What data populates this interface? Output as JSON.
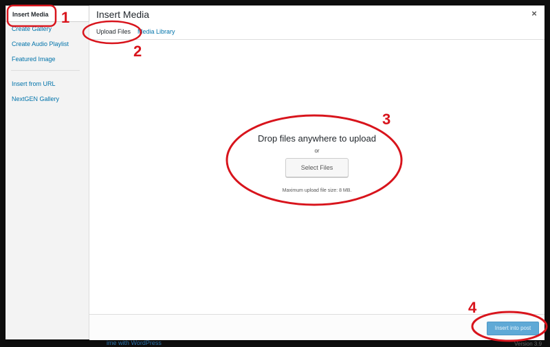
{
  "backdrop": {
    "footer_text": "ime with WordPress",
    "version": "Version 3.9"
  },
  "menu": {
    "items": [
      {
        "label": "Insert Media",
        "active": true
      },
      {
        "label": "Create Gallery"
      },
      {
        "label": "Create Audio Playlist"
      },
      {
        "label": "Featured Image"
      },
      {
        "label": "Insert from URL"
      },
      {
        "label": "NextGEN Gallery"
      }
    ]
  },
  "frame": {
    "title": "Insert Media",
    "close_glyph": "×",
    "tabs": [
      {
        "label": "Upload Files",
        "active": true
      },
      {
        "label": "Media Library"
      }
    ]
  },
  "uploader": {
    "drop_title": "Drop files anywhere to upload",
    "or_text": "or",
    "select_button": "Select Files",
    "max_size": "Maximum upload file size: 8 MB."
  },
  "toolbar": {
    "insert_button": "Insert into post"
  },
  "annotations": {
    "color": "#d8141c",
    "labels": [
      "1",
      "2",
      "3",
      "4"
    ]
  }
}
